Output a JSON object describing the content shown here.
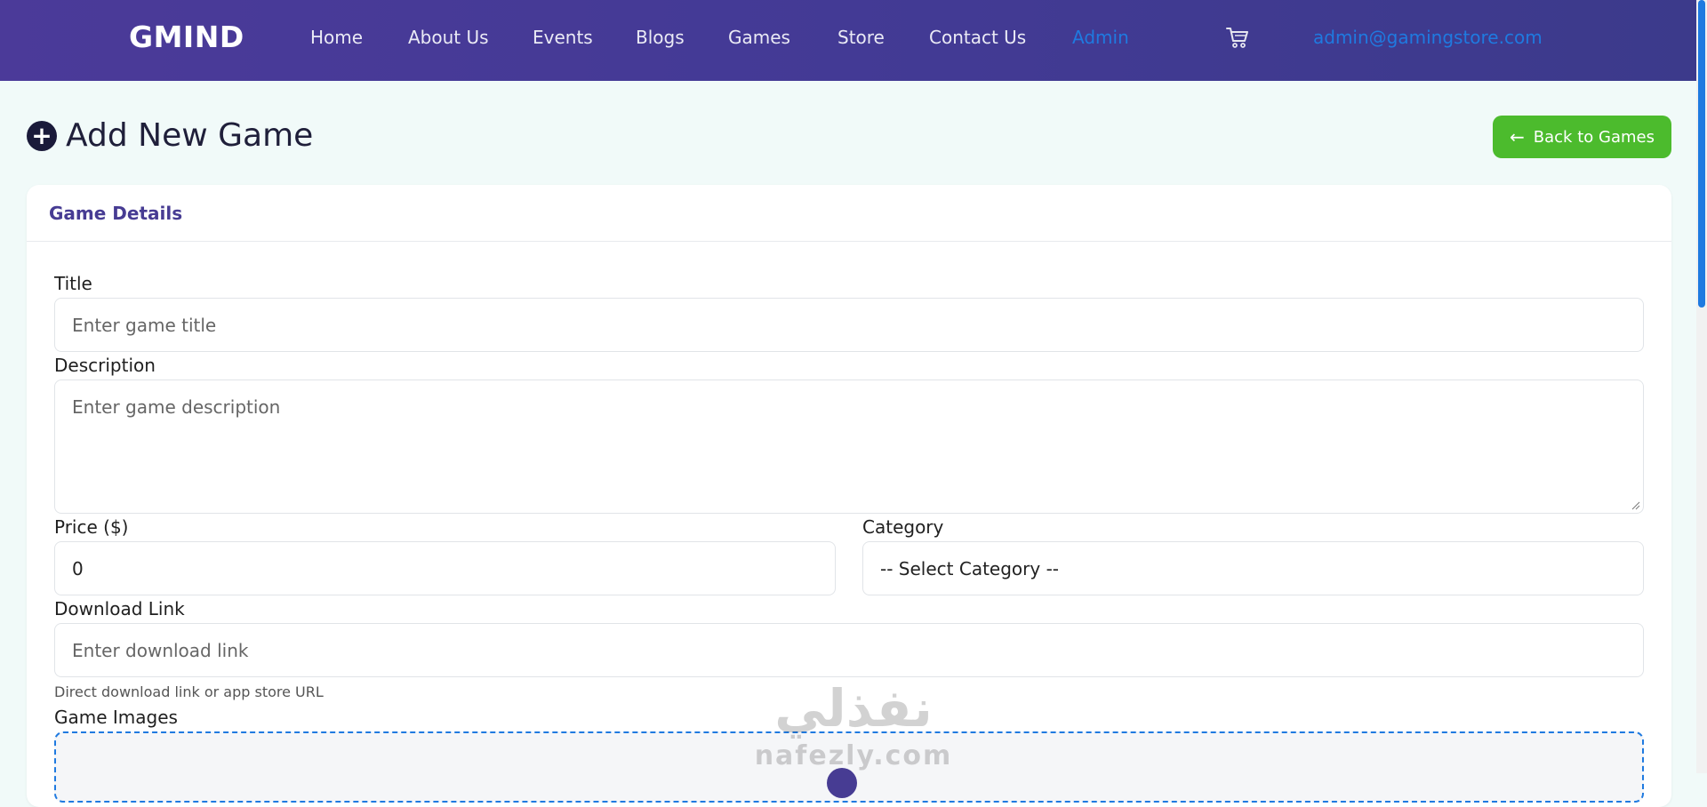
{
  "nav": {
    "brand": "GMIND",
    "items": [
      {
        "label": "Home"
      },
      {
        "label": "About Us"
      },
      {
        "label": "Events"
      },
      {
        "label": "Blogs"
      },
      {
        "label": "Games"
      },
      {
        "label": "Store"
      },
      {
        "label": "Contact Us"
      },
      {
        "label": "Admin"
      }
    ],
    "user_email": "admin@gamingstore.com",
    "active_color": "#1f7ae0"
  },
  "page": {
    "title": "Add New Game",
    "back_label": "Back to Games"
  },
  "card": {
    "title": "Game Details"
  },
  "form": {
    "title_label": "Title",
    "title_placeholder": "Enter game title",
    "description_label": "Description",
    "description_placeholder": "Enter game description",
    "price_label": "Price ($)",
    "price_value": "0",
    "category_label": "Category",
    "category_value": "-- Select Category --",
    "download_label": "Download Link",
    "download_placeholder": "Enter download link",
    "download_help": "Direct download link or app store URL",
    "images_label": "Game Images"
  },
  "watermark": {
    "arabic": "نفذلي",
    "latin": "nafezly.com"
  },
  "colors": {
    "nav_bg": "#433a95",
    "accent": "#1f7ae0",
    "success": "#4cbb2d",
    "card_title": "#473c93"
  }
}
